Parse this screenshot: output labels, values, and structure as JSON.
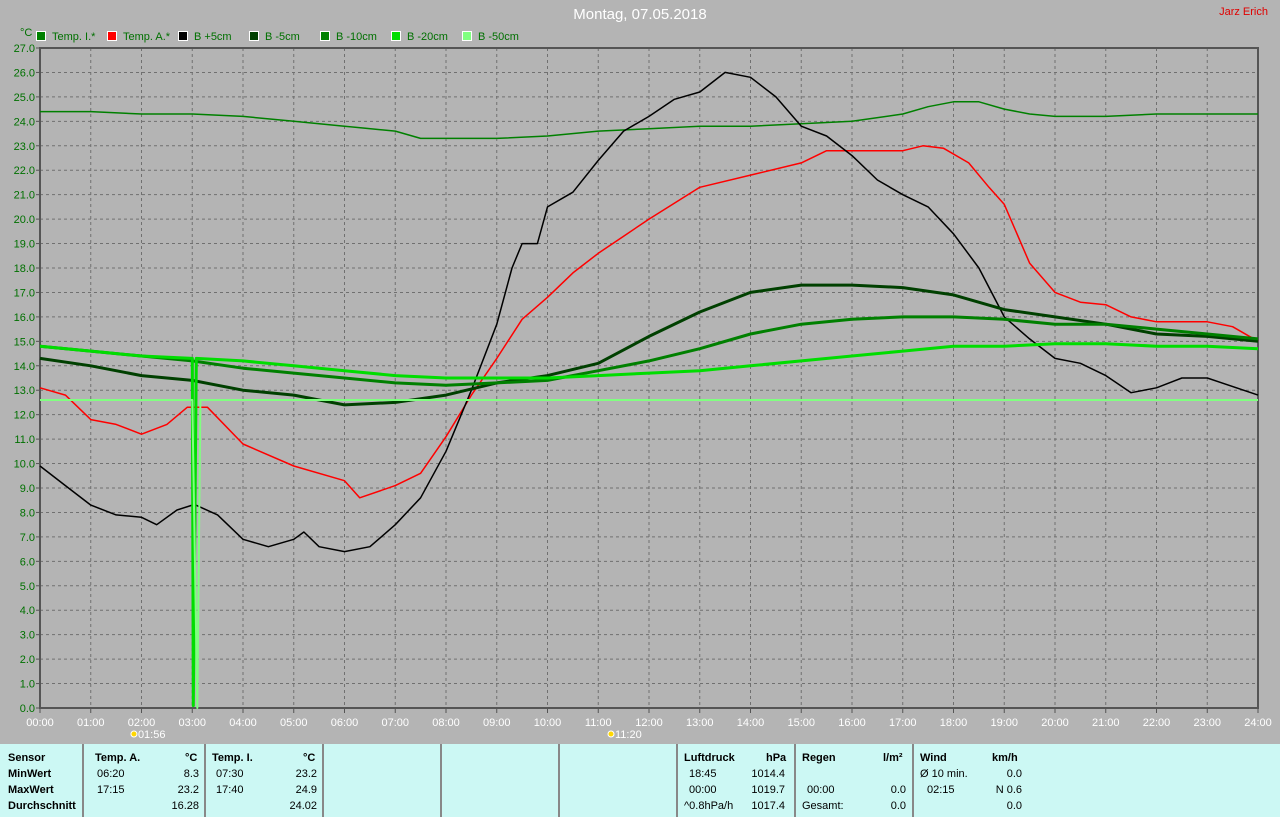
{
  "title": "Montag, 07.05.2018",
  "author": "Jarz Erich",
  "chart_data": {
    "type": "line",
    "title": "Montag, 07.05.2018",
    "ylabel": "°C",
    "xlabel": "",
    "xlim": [
      0,
      24
    ],
    "ylim": [
      0,
      27
    ],
    "grid": true,
    "legend_placement": "top",
    "x_ticks": [
      "00:00",
      "01:00",
      "02:00",
      "03:00",
      "04:00",
      "05:00",
      "06:00",
      "07:00",
      "08:00",
      "09:00",
      "10:00",
      "11:00",
      "12:00",
      "13:00",
      "14:00",
      "15:00",
      "16:00",
      "17:00",
      "18:00",
      "19:00",
      "20:00",
      "21:00",
      "22:00",
      "23:00",
      "24:00"
    ],
    "y_ticks": [
      "0.0",
      "1.0",
      "2.0",
      "3.0",
      "4.0",
      "5.0",
      "6.0",
      "7.0",
      "8.0",
      "9.0",
      "10.0",
      "11.0",
      "12.0",
      "13.0",
      "14.0",
      "15.0",
      "16.0",
      "17.0",
      "18.0",
      "19.0",
      "20.0",
      "21.0",
      "22.0",
      "23.0",
      "24.0",
      "25.0",
      "26.0",
      "27.0"
    ],
    "markers": [
      {
        "label": "01:56",
        "x": 1.93
      },
      {
        "label": "11:20",
        "x": 11.33
      }
    ],
    "series": [
      {
        "name": "Temp. I.*",
        "color": "#008000",
        "width": 1.5,
        "points": [
          [
            0,
            24.4
          ],
          [
            1,
            24.4
          ],
          [
            2,
            24.3
          ],
          [
            3,
            24.3
          ],
          [
            4,
            24.2
          ],
          [
            5,
            24.0
          ],
          [
            6,
            23.8
          ],
          [
            7,
            23.6
          ],
          [
            7.5,
            23.3
          ],
          [
            8,
            23.3
          ],
          [
            9,
            23.3
          ],
          [
            10,
            23.4
          ],
          [
            11,
            23.6
          ],
          [
            12,
            23.7
          ],
          [
            13,
            23.8
          ],
          [
            14,
            23.8
          ],
          [
            15,
            23.9
          ],
          [
            16,
            24.0
          ],
          [
            17,
            24.3
          ],
          [
            17.5,
            24.6
          ],
          [
            18,
            24.8
          ],
          [
            18.5,
            24.8
          ],
          [
            19,
            24.5
          ],
          [
            19.5,
            24.3
          ],
          [
            20,
            24.2
          ],
          [
            21,
            24.2
          ],
          [
            22,
            24.3
          ],
          [
            24,
            24.3
          ]
        ]
      },
      {
        "name": "Temp. A.*",
        "color": "#ff0000",
        "width": 1.5,
        "points": [
          [
            0,
            13.1
          ],
          [
            0.5,
            12.8
          ],
          [
            1,
            11.8
          ],
          [
            1.5,
            11.6
          ],
          [
            2,
            11.2
          ],
          [
            2.5,
            11.6
          ],
          [
            2.9,
            12.3
          ],
          [
            3.3,
            12.3
          ],
          [
            4,
            10.8
          ],
          [
            5,
            9.9
          ],
          [
            6,
            9.3
          ],
          [
            6.3,
            8.6
          ],
          [
            7,
            9.1
          ],
          [
            7.5,
            9.6
          ],
          [
            8,
            11.1
          ],
          [
            8.5,
            12.8
          ],
          [
            9,
            14.3
          ],
          [
            9.5,
            15.9
          ],
          [
            10,
            16.8
          ],
          [
            10.5,
            17.8
          ],
          [
            11,
            18.6
          ],
          [
            11.5,
            19.3
          ],
          [
            12,
            20.0
          ],
          [
            13,
            21.3
          ],
          [
            14,
            21.8
          ],
          [
            15,
            22.3
          ],
          [
            15.5,
            22.8
          ],
          [
            16,
            22.8
          ],
          [
            17,
            22.8
          ],
          [
            17.4,
            23.0
          ],
          [
            17.8,
            22.9
          ],
          [
            18.3,
            22.3
          ],
          [
            18.7,
            21.3
          ],
          [
            19,
            20.6
          ],
          [
            19.5,
            18.2
          ],
          [
            20,
            17.0
          ],
          [
            20.5,
            16.6
          ],
          [
            21,
            16.5
          ],
          [
            21.5,
            16.0
          ],
          [
            22,
            15.8
          ],
          [
            23,
            15.8
          ],
          [
            23.5,
            15.6
          ],
          [
            24,
            15.0
          ]
        ]
      },
      {
        "name": "B +5cm",
        "color": "#000000",
        "width": 1.5,
        "points": [
          [
            0,
            9.9
          ],
          [
            0.5,
            9.1
          ],
          [
            1,
            8.3
          ],
          [
            1.5,
            7.9
          ],
          [
            2,
            7.8
          ],
          [
            2.3,
            7.5
          ],
          [
            2.7,
            8.1
          ],
          [
            3.0,
            8.3
          ],
          [
            3.03,
            3.3
          ],
          [
            3.07,
            8.3
          ],
          [
            3.5,
            7.9
          ],
          [
            4,
            6.9
          ],
          [
            4.5,
            6.6
          ],
          [
            5,
            6.9
          ],
          [
            5.2,
            7.2
          ],
          [
            5.5,
            6.6
          ],
          [
            6,
            6.4
          ],
          [
            6.5,
            6.6
          ],
          [
            7,
            7.5
          ],
          [
            7.5,
            8.6
          ],
          [
            8,
            10.5
          ],
          [
            8.5,
            13.0
          ],
          [
            9,
            15.7
          ],
          [
            9.3,
            18.0
          ],
          [
            9.5,
            19.0
          ],
          [
            9.8,
            19.0
          ],
          [
            10,
            20.5
          ],
          [
            10.5,
            21.1
          ],
          [
            11,
            22.4
          ],
          [
            11.5,
            23.6
          ],
          [
            12,
            24.2
          ],
          [
            12.5,
            24.9
          ],
          [
            13,
            25.2
          ],
          [
            13.5,
            26.0
          ],
          [
            14,
            25.8
          ],
          [
            14.5,
            25.0
          ],
          [
            15,
            23.8
          ],
          [
            15.5,
            23.4
          ],
          [
            16,
            22.6
          ],
          [
            16.5,
            21.6
          ],
          [
            17,
            21.0
          ],
          [
            17.5,
            20.5
          ],
          [
            18,
            19.4
          ],
          [
            18.5,
            18.0
          ],
          [
            19,
            16.0
          ],
          [
            19.5,
            15.1
          ],
          [
            20,
            14.3
          ],
          [
            20.5,
            14.1
          ],
          [
            21,
            13.6
          ],
          [
            21.5,
            12.9
          ],
          [
            22,
            13.1
          ],
          [
            22.5,
            13.5
          ],
          [
            23,
            13.5
          ],
          [
            24,
            12.8
          ]
        ]
      },
      {
        "name": "B -5cm",
        "color": "#004000",
        "width": 3,
        "points": [
          [
            0,
            14.3
          ],
          [
            1,
            14.0
          ],
          [
            2,
            13.6
          ],
          [
            3,
            13.4
          ],
          [
            4,
            13.0
          ],
          [
            5,
            12.8
          ],
          [
            6,
            12.4
          ],
          [
            7,
            12.5
          ],
          [
            8,
            12.8
          ],
          [
            9,
            13.3
          ],
          [
            10,
            13.6
          ],
          [
            11,
            14.1
          ],
          [
            12,
            15.2
          ],
          [
            13,
            16.2
          ],
          [
            14,
            17.0
          ],
          [
            15,
            17.3
          ],
          [
            16,
            17.3
          ],
          [
            17,
            17.2
          ],
          [
            18,
            16.9
          ],
          [
            19,
            16.3
          ],
          [
            20,
            16.0
          ],
          [
            21,
            15.7
          ],
          [
            22,
            15.3
          ],
          [
            23,
            15.2
          ],
          [
            24,
            15.0
          ]
        ]
      },
      {
        "name": "B -10cm",
        "color": "#008000",
        "width": 3,
        "points": [
          [
            0,
            14.8
          ],
          [
            1,
            14.6
          ],
          [
            2,
            14.4
          ],
          [
            3,
            14.2
          ],
          [
            4,
            13.9
          ],
          [
            5,
            13.7
          ],
          [
            6,
            13.5
          ],
          [
            7,
            13.3
          ],
          [
            8,
            13.2
          ],
          [
            9,
            13.3
          ],
          [
            10,
            13.4
          ],
          [
            11,
            13.8
          ],
          [
            12,
            14.2
          ],
          [
            13,
            14.7
          ],
          [
            14,
            15.3
          ],
          [
            15,
            15.7
          ],
          [
            16,
            15.9
          ],
          [
            17,
            16.0
          ],
          [
            18,
            16.0
          ],
          [
            19,
            15.9
          ],
          [
            20,
            15.7
          ],
          [
            21,
            15.7
          ],
          [
            22,
            15.5
          ],
          [
            23,
            15.3
          ],
          [
            24,
            15.1
          ]
        ]
      },
      {
        "name": "B -20cm",
        "color": "#00dd00",
        "width": 3,
        "points": [
          [
            0,
            14.8
          ],
          [
            1,
            14.6
          ],
          [
            2,
            14.4
          ],
          [
            3,
            14.3
          ],
          [
            3.02,
            0.1
          ],
          [
            3.08,
            14.3
          ],
          [
            4,
            14.2
          ],
          [
            5,
            14.0
          ],
          [
            6,
            13.8
          ],
          [
            7,
            13.6
          ],
          [
            8,
            13.5
          ],
          [
            9,
            13.5
          ],
          [
            10,
            13.5
          ],
          [
            11,
            13.6
          ],
          [
            12,
            13.7
          ],
          [
            13,
            13.8
          ],
          [
            14,
            14.0
          ],
          [
            15,
            14.2
          ],
          [
            16,
            14.4
          ],
          [
            17,
            14.6
          ],
          [
            18,
            14.8
          ],
          [
            19,
            14.8
          ],
          [
            20,
            14.9
          ],
          [
            21,
            14.9
          ],
          [
            22,
            14.8
          ],
          [
            23,
            14.8
          ],
          [
            24,
            14.7
          ]
        ]
      },
      {
        "name": "B -50cm",
        "color": "#80ff80",
        "width": 2,
        "points": [
          [
            0,
            12.6
          ],
          [
            3.0,
            12.6
          ],
          [
            3.1,
            0.0
          ],
          [
            3.16,
            12.6
          ],
          [
            24,
            12.6
          ]
        ]
      }
    ]
  },
  "panel": {
    "sensor": {
      "header": "Sensor",
      "rows": [
        "MinWert",
        "MaxWert",
        "Durchschnitt"
      ]
    },
    "temp_a": {
      "header": "Temp. A.",
      "unit": "°C",
      "min_time": "06:20",
      "min": "8.3",
      "max_time": "17:15",
      "max": "23.2",
      "avg": "16.28"
    },
    "temp_i": {
      "header": "Temp. I.",
      "unit": "°C",
      "min_time": "07:30",
      "min": "23.2",
      "max_time": "17:40",
      "max": "24.9",
      "avg": "24.02"
    },
    "pressure": {
      "header": "Luftdruck",
      "unit": "hPa",
      "min_time": "18:45",
      "min": "1014.4",
      "max_time": "00:00",
      "max": "1019.7",
      "trend": "^0.8hPa/h",
      "avg": "1017.4"
    },
    "rain": {
      "header": "Regen",
      "unit": "l/m²",
      "max_time": "00:00",
      "max": "0.0",
      "total_label": "Gesamt:",
      "total": "0.0"
    },
    "wind": {
      "header": "Wind",
      "unit": "km/h",
      "avg_label": "Ø 10 min.",
      "avg": "0.0",
      "max_time": "02:15",
      "max": "N 0.6",
      "third": "0.0"
    }
  }
}
